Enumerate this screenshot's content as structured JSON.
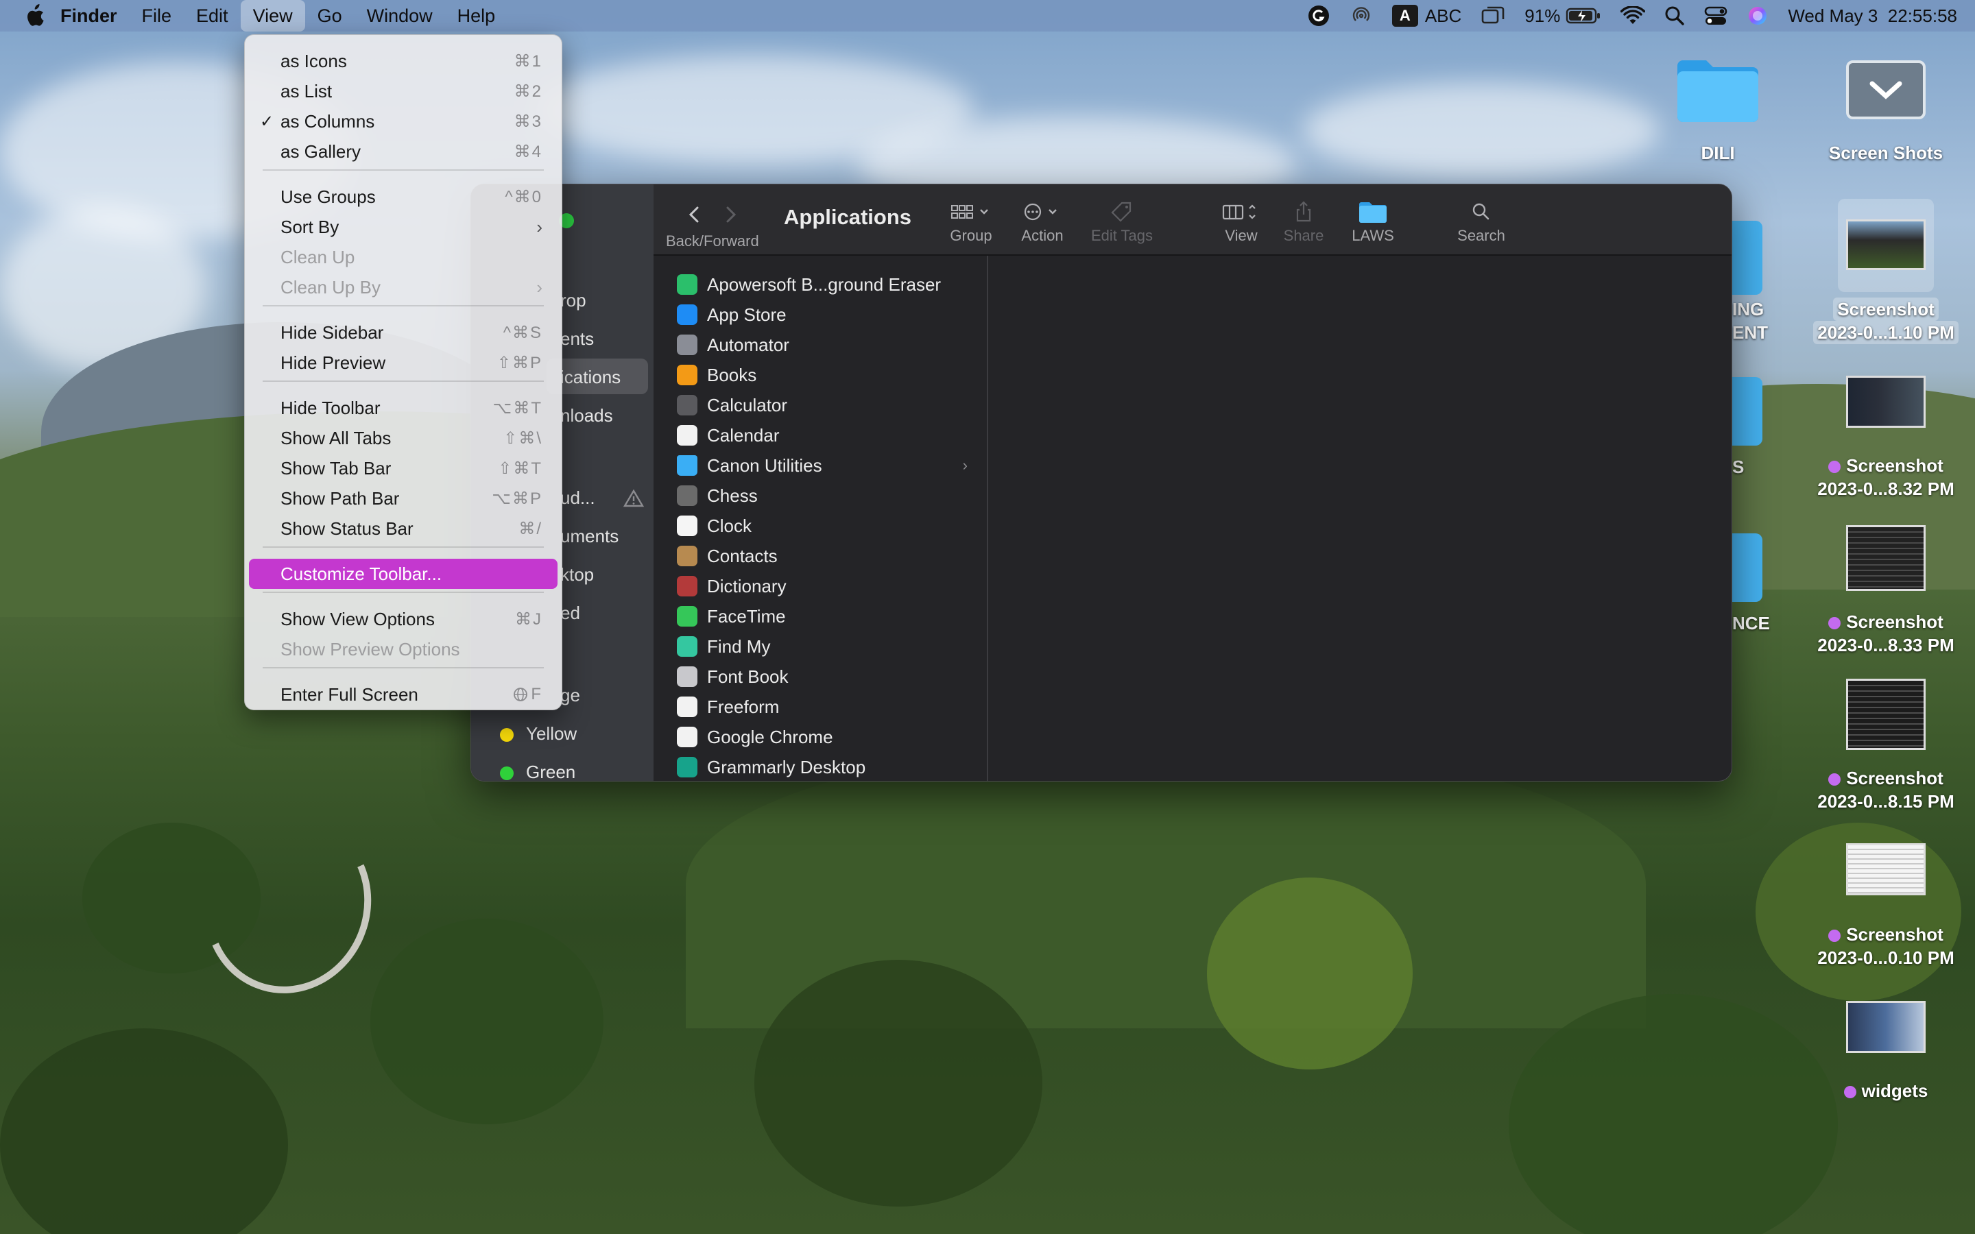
{
  "menubar": {
    "app": "Finder",
    "items": [
      "File",
      "Edit",
      "View",
      "Go",
      "Window",
      "Help"
    ],
    "active_menu": "View",
    "input_source": "ABC",
    "input_badge": "A",
    "battery": "91%",
    "datetime": "Wed May 3  22:55:58",
    "icons": [
      "apple-icon",
      "grammarly-icon",
      "airdrop-icon",
      "input-source-icon",
      "screen-mirroring-icon",
      "battery-icon",
      "wifi-icon",
      "spotlight-icon",
      "control-center-icon",
      "siri-icon"
    ]
  },
  "view_menu": {
    "items": [
      {
        "label": "as Icons",
        "shortcut": "⌘1"
      },
      {
        "label": "as List",
        "shortcut": "⌘2"
      },
      {
        "label": "as Columns",
        "shortcut": "⌘3",
        "checked": true
      },
      {
        "label": "as Gallery",
        "shortcut": "⌘4"
      },
      {
        "label": "Use Groups",
        "shortcut": "^⌘0"
      },
      {
        "label": "Sort By",
        "submenu": true
      },
      {
        "label": "Clean Up",
        "disabled": true
      },
      {
        "label": "Clean Up By",
        "submenu": true,
        "disabled": true
      },
      {
        "label": "Hide Sidebar",
        "shortcut": "^⌘S"
      },
      {
        "label": "Hide Preview",
        "shortcut": "⇧⌘P"
      },
      {
        "label": "Hide Toolbar",
        "shortcut": "⌥⌘T"
      },
      {
        "label": "Show All Tabs",
        "shortcut": "⇧⌘\\"
      },
      {
        "label": "Show Tab Bar",
        "shortcut": "⇧⌘T"
      },
      {
        "label": "Show Path Bar",
        "shortcut": "⌥⌘P"
      },
      {
        "label": "Show Status Bar",
        "shortcut": "⌘/"
      },
      {
        "label": "Customize Toolbar...",
        "highlighted": true
      },
      {
        "label": "Show View Options",
        "shortcut": "⌘J"
      },
      {
        "label": "Show Preview Options",
        "disabled": true
      },
      {
        "label": "Enter Full Screen",
        "shortcut": "F"
      }
    ],
    "check_mark": "✓",
    "submenu_glyph": "›"
  },
  "finder": {
    "title": "Applications",
    "back_forward_label": "Back/Forward",
    "toolbar": {
      "group": "Group",
      "action": "Action",
      "edit_tags": "Edit Tags",
      "view": "View",
      "share": "Share",
      "laws": "LAWS",
      "search": "Search"
    },
    "sidebar": {
      "items": [
        "rop",
        "ents",
        "ications",
        "nloads",
        "ud...",
        "uments",
        "ktop",
        "ed",
        "ge"
      ],
      "tags": [
        {
          "label": "Yellow",
          "color": "#f5d90a"
        },
        {
          "label": "Green",
          "color": "#2fd13a"
        }
      ]
    },
    "apps": [
      {
        "name": "Apowersoft B...ground Eraser",
        "icon": "apowersoft-icon",
        "color": "#2bbf6b"
      },
      {
        "name": "App Store",
        "icon": "app-store-icon",
        "color": "#1e8cf5"
      },
      {
        "name": "Automator",
        "icon": "automator-icon",
        "color": "#8a8d96"
      },
      {
        "name": "Books",
        "icon": "books-icon",
        "color": "#f39a16"
      },
      {
        "name": "Calculator",
        "icon": "calculator-icon",
        "color": "#5a5a5e"
      },
      {
        "name": "Calendar",
        "icon": "calendar-icon",
        "color": "#f2f2f2"
      },
      {
        "name": "Canon Utilities",
        "icon": "folder-icon",
        "color": "#3aaef5",
        "folder": true
      },
      {
        "name": "Chess",
        "icon": "chess-icon",
        "color": "#6b6b6b"
      },
      {
        "name": "Clock",
        "icon": "clock-icon",
        "color": "#f5f5f5"
      },
      {
        "name": "Contacts",
        "icon": "contacts-icon",
        "color": "#b78a50"
      },
      {
        "name": "Dictionary",
        "icon": "dictionary-icon",
        "color": "#b33a3a"
      },
      {
        "name": "FaceTime",
        "icon": "facetime-icon",
        "color": "#35c759"
      },
      {
        "name": "Find My",
        "icon": "find-my-icon",
        "color": "#34c7a0"
      },
      {
        "name": "Font Book",
        "icon": "font-book-icon",
        "color": "#c8c8cc"
      },
      {
        "name": "Freeform",
        "icon": "freeform-icon",
        "color": "#f2f2f2"
      },
      {
        "name": "Google Chrome",
        "icon": "chrome-icon",
        "color": "#f2f2f2"
      },
      {
        "name": "Grammarly Desktop",
        "icon": "grammarly-icon",
        "color": "#17a38b"
      }
    ]
  },
  "desktop": {
    "folders": [
      {
        "label": "DILI"
      },
      {
        "label": "Screen Shots"
      }
    ],
    "partial_labels": [
      "ING",
      "ENT",
      "S",
      "NCE"
    ],
    "screenshots": [
      {
        "line1": "Screenshot",
        "line2": "2023-0...1.10 PM",
        "tagged": false
      },
      {
        "line1": "Screenshot",
        "line2": "2023-0...8.32 PM",
        "tagged": true
      },
      {
        "line1": "Screenshot",
        "line2": "2023-0...8.33 PM",
        "tagged": true
      },
      {
        "line1": "Screenshot",
        "line2": "2023-0...8.15 PM",
        "tagged": true
      },
      {
        "line1": "Screenshot",
        "line2": "2023-0...0.10 PM",
        "tagged": true
      },
      {
        "line1": "widgets",
        "line2": "",
        "tagged": true
      }
    ]
  }
}
